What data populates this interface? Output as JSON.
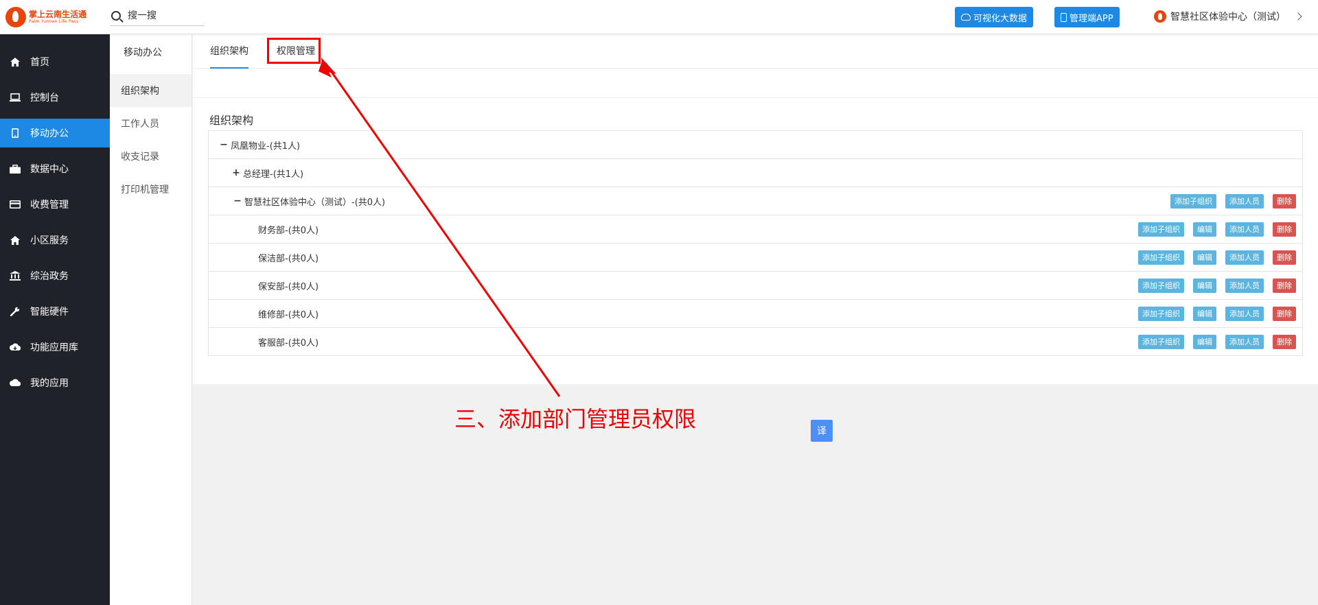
{
  "brand": {
    "name": "掌上云南生活通",
    "sub": "Palm Yunnan Life Pass"
  },
  "search": {
    "placeholder": "搜一搜"
  },
  "header": {
    "bigdata_label": "可视化大数据",
    "app_label": "管理端APP",
    "community_name": "智慧社区体验中心（测试）"
  },
  "sidebar": {
    "items": [
      {
        "label": "首页",
        "icon": "home-icon"
      },
      {
        "label": "控制台",
        "icon": "laptop-icon"
      },
      {
        "label": "移动办公",
        "icon": "tablet-icon",
        "active": true
      },
      {
        "label": "数据中心",
        "icon": "briefcase-icon"
      },
      {
        "label": "收费管理",
        "icon": "credit-card-icon"
      },
      {
        "label": "小区服务",
        "icon": "home-icon"
      },
      {
        "label": "综治政务",
        "icon": "bank-icon"
      },
      {
        "label": "智能硬件",
        "icon": "wrench-icon"
      },
      {
        "label": "功能应用库",
        "icon": "cloud-download-icon"
      },
      {
        "label": "我的应用",
        "icon": "cloud-icon"
      }
    ]
  },
  "subnav": {
    "title": "移动办公",
    "items": [
      {
        "label": "组织架构",
        "active": true
      },
      {
        "label": "工作人员"
      },
      {
        "label": "收支记录"
      },
      {
        "label": "打印机管理"
      }
    ]
  },
  "tabs": {
    "org": "组织架构",
    "perm": "权限管理"
  },
  "section_title": "组织架构",
  "actions": {
    "add_sub": "添加子组织",
    "edit": "编辑",
    "add_person": "添加人员",
    "delete": "删除"
  },
  "tree": [
    {
      "label": "凤凰物业-(共1人)",
      "toggle": "−"
    },
    {
      "label": "总经理-(共1人)",
      "toggle": "+"
    },
    {
      "label": "智慧社区体验中心（测试）-(共0人)",
      "toggle": "−"
    },
    {
      "label": "财务部-(共0人)",
      "toggle": ""
    },
    {
      "label": "保洁部-(共0人)",
      "toggle": ""
    },
    {
      "label": "保安部-(共0人)",
      "toggle": ""
    },
    {
      "label": "维修部-(共0人)",
      "toggle": ""
    },
    {
      "label": "客服部-(共0人)",
      "toggle": ""
    }
  ],
  "annotation": {
    "text": "三、添加部门管理员权限",
    "color": "#ee0000"
  },
  "translate_label": "译"
}
